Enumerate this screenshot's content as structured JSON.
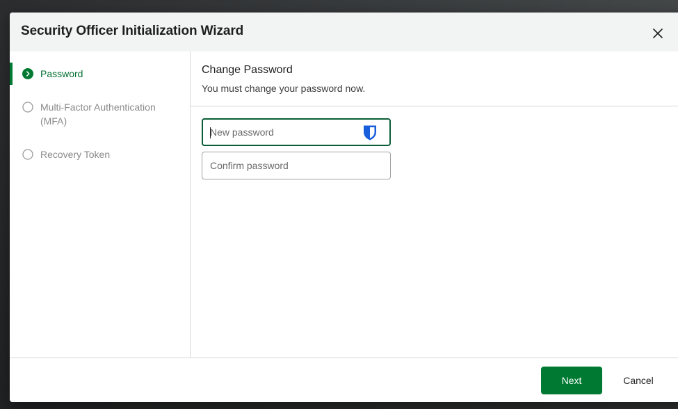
{
  "dialog": {
    "title": "Security Officer Initialization Wizard",
    "close_icon": "close-icon"
  },
  "steps": [
    {
      "label": "Password",
      "state": "active",
      "icon": "chevron-right-circle-icon"
    },
    {
      "label": "Multi-Factor Authentication (MFA)",
      "state": "pending",
      "icon": "empty-circle-icon"
    },
    {
      "label": "Recovery Token",
      "state": "pending",
      "icon": "empty-circle-icon"
    }
  ],
  "content": {
    "title": "Change Password",
    "subtitle": "You must change your password now."
  },
  "form": {
    "new_password": {
      "value": "",
      "placeholder": "New password"
    },
    "confirm_password": {
      "value": "",
      "placeholder": "Confirm password"
    },
    "password_manager_icon": "bitwarden-shield-icon"
  },
  "footer": {
    "next_label": "Next",
    "cancel_label": "Cancel"
  },
  "colors": {
    "accent": "#007a33",
    "active_text": "#006f31",
    "focus_border": "#0a5c36",
    "shield_blue": "#175ddc",
    "header_bg": "#f2f4f3"
  }
}
